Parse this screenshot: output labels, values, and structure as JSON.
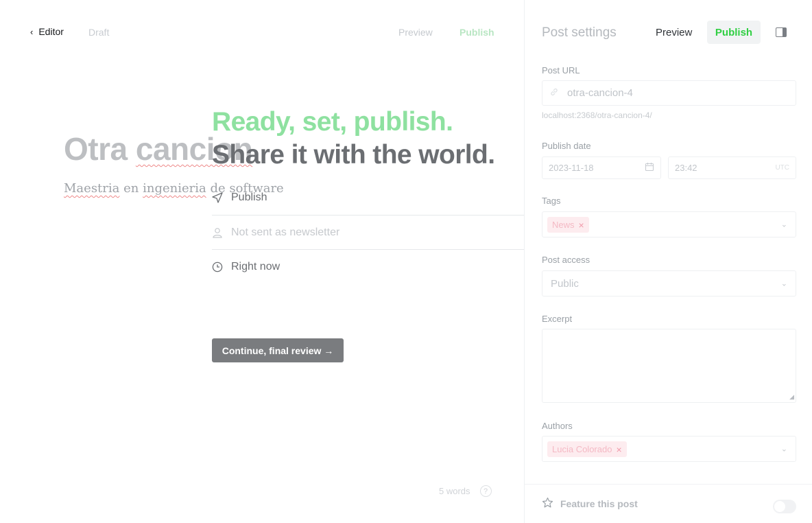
{
  "editor": {
    "back_label": "Editor",
    "status": "Draft",
    "preview_label": "Preview",
    "publish_label": "Publish",
    "title_part1": "Otra ",
    "title_part2": "cancion",
    "subtitle_part1": "Maestria",
    "subtitle_part2": " en ",
    "subtitle_part3": "ingenieria",
    "subtitle_part4": " de software",
    "word_count": "5 words",
    "help_glyph": "?"
  },
  "publish_flow": {
    "heading_line1": "Ready, set, publish.",
    "heading_line2": "Share it with the world.",
    "options": [
      {
        "icon": "send-icon",
        "label": "Publish"
      },
      {
        "icon": "user-icon",
        "label": "Not sent as newsletter"
      },
      {
        "icon": "clock-icon",
        "label": "Right now"
      }
    ],
    "continue_label": "Continue, final review →"
  },
  "settings": {
    "title": "Post settings",
    "preview_label": "Preview",
    "publish_label": "Publish",
    "post_url_label": "Post URL",
    "post_url_value": "otra-cancion-4",
    "post_url_hint": "localhost:2368/otra-cancion-4/",
    "publish_date_label": "Publish date",
    "date_value": "2023-11-18",
    "time_value": "23:42",
    "timezone": "UTC",
    "tags_label": "Tags",
    "tags": [
      "News"
    ],
    "post_access_label": "Post access",
    "post_access_value": "Public",
    "excerpt_label": "Excerpt",
    "authors_label": "Authors",
    "authors": [
      "Lucia Colorado"
    ],
    "feature_label": "Feature this post",
    "feature_enabled": false
  },
  "colors": {
    "accent_green": "#30cf43",
    "headline_green": "#8ee1a0",
    "token_pink": "#fdecef"
  }
}
